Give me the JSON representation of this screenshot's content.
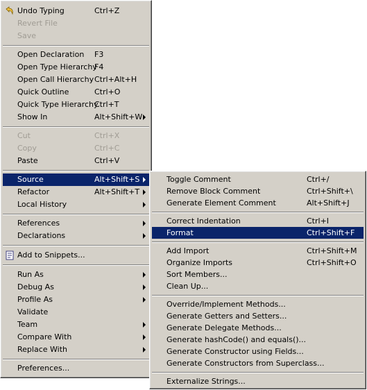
{
  "main_menu": {
    "items": [
      {
        "label": "Undo Typing",
        "shortcut": "Ctrl+Z"
      },
      {
        "label": "Revert File",
        "shortcut": ""
      },
      {
        "label": "Save",
        "shortcut": ""
      },
      {
        "label": "Open Declaration",
        "shortcut": "F3"
      },
      {
        "label": "Open Type Hierarchy",
        "shortcut": "F4"
      },
      {
        "label": "Open Call Hierarchy",
        "shortcut": "Ctrl+Alt+H"
      },
      {
        "label": "Quick Outline",
        "shortcut": "Ctrl+O"
      },
      {
        "label": "Quick Type Hierarchy",
        "shortcut": "Ctrl+T"
      },
      {
        "label": "Show In",
        "shortcut": "Alt+Shift+W"
      },
      {
        "label": "Cut",
        "shortcut": "Ctrl+X"
      },
      {
        "label": "Copy",
        "shortcut": "Ctrl+C"
      },
      {
        "label": "Paste",
        "shortcut": "Ctrl+V"
      },
      {
        "label": "Source",
        "shortcut": "Alt+Shift+S"
      },
      {
        "label": "Refactor",
        "shortcut": "Alt+Shift+T"
      },
      {
        "label": "Local History",
        "shortcut": ""
      },
      {
        "label": "References",
        "shortcut": ""
      },
      {
        "label": "Declarations",
        "shortcut": ""
      },
      {
        "label": "Add to Snippets...",
        "shortcut": ""
      },
      {
        "label": "Run As",
        "shortcut": ""
      },
      {
        "label": "Debug As",
        "shortcut": ""
      },
      {
        "label": "Profile As",
        "shortcut": ""
      },
      {
        "label": "Validate",
        "shortcut": ""
      },
      {
        "label": "Team",
        "shortcut": ""
      },
      {
        "label": "Compare With",
        "shortcut": ""
      },
      {
        "label": "Replace With",
        "shortcut": ""
      },
      {
        "label": "Preferences...",
        "shortcut": ""
      }
    ]
  },
  "source_submenu": {
    "items": [
      {
        "label": "Toggle Comment",
        "shortcut": "Ctrl+/"
      },
      {
        "label": "Remove Block Comment",
        "shortcut": "Ctrl+Shift+\\"
      },
      {
        "label": "Generate Element Comment",
        "shortcut": "Alt+Shift+J"
      },
      {
        "label": "Correct Indentation",
        "shortcut": "Ctrl+I"
      },
      {
        "label": "Format",
        "shortcut": "Ctrl+Shift+F"
      },
      {
        "label": "Add Import",
        "shortcut": "Ctrl+Shift+M"
      },
      {
        "label": "Organize Imports",
        "shortcut": "Ctrl+Shift+O"
      },
      {
        "label": "Sort Members...",
        "shortcut": ""
      },
      {
        "label": "Clean Up...",
        "shortcut": ""
      },
      {
        "label": "Override/Implement Methods...",
        "shortcut": ""
      },
      {
        "label": "Generate Getters and Setters...",
        "shortcut": ""
      },
      {
        "label": "Generate Delegate Methods...",
        "shortcut": ""
      },
      {
        "label": "Generate hashCode() and equals()...",
        "shortcut": ""
      },
      {
        "label": "Generate Constructor using Fields...",
        "shortcut": ""
      },
      {
        "label": "Generate Constructors from Superclass...",
        "shortcut": ""
      },
      {
        "label": "Externalize Strings...",
        "shortcut": ""
      }
    ]
  },
  "colors": {
    "menu_bg": "#d4d0c8",
    "highlight": "#0a246a",
    "disabled": "#a09c94"
  },
  "icons": {
    "undo": "undo-arrow-icon",
    "snippets": "snippets-icon",
    "submenu": "submenu-arrow-icon"
  }
}
